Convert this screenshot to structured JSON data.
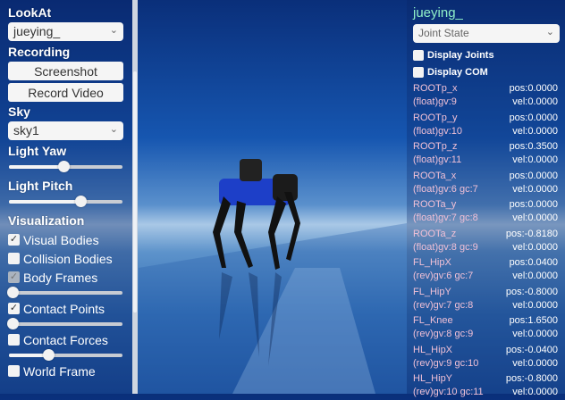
{
  "left": {
    "lookat_label": "LookAt",
    "lookat_value": "jueying_",
    "recording_label": "Recording",
    "screenshot_button": "Screenshot",
    "record_button": "Record Video",
    "sky_label": "Sky",
    "sky_value": "sky1",
    "light_yaw_label": "Light Yaw",
    "light_yaw_value": 0.48,
    "light_pitch_label": "Light Pitch",
    "light_pitch_value": 0.63,
    "visualization_label": "Visualization",
    "items": [
      {
        "label": "Visual Bodies",
        "checked": true
      },
      {
        "label": "Collision Bodies",
        "checked": false
      },
      {
        "label": "Body Frames",
        "checked": true,
        "disabled": true,
        "slider": 0.03
      },
      {
        "label": "Contact Points",
        "checked": true,
        "slider": 0.03
      },
      {
        "label": "Contact Forces",
        "checked": false,
        "slider": 0.35
      },
      {
        "label": "World Frame",
        "checked": false
      }
    ]
  },
  "right": {
    "title": "jueying_",
    "mode": "Joint State",
    "display_joints": "Display Joints",
    "display_com": "Display COM",
    "joints": [
      {
        "name": "ROOTp_x",
        "info": "(float)gv:9",
        "pos": "pos:0.0000",
        "vel": "vel:0.0000"
      },
      {
        "name": "ROOTp_y",
        "info": "(float)gv:10",
        "pos": "pos:0.0000",
        "vel": "vel:0.0000"
      },
      {
        "name": "ROOTp_z",
        "info": "(float)gv:11",
        "pos": "pos:0.3500",
        "vel": "vel:0.0000"
      },
      {
        "name": "ROOTa_x",
        "info": "(float)gv:6 gc:7",
        "pos": "pos:0.0000",
        "vel": "vel:0.0000"
      },
      {
        "name": "ROOTa_y",
        "info": "(float)gv:7 gc:8",
        "pos": "pos:0.0000",
        "vel": "vel:0.0000"
      },
      {
        "name": "ROOTa_z",
        "info": "(float)gv:8 gc:9",
        "pos": "pos:-0.8180",
        "vel": "vel:0.0000"
      },
      {
        "name": "FL_HipX",
        "info": "(rev)gv:6 gc:7",
        "pos": "pos:0.0400",
        "vel": "vel:0.0000"
      },
      {
        "name": "FL_HipY",
        "info": "(rev)gv:7 gc:8",
        "pos": "pos:-0.8000",
        "vel": "vel:0.0000"
      },
      {
        "name": "FL_Knee",
        "info": "(rev)gv:8 gc:9",
        "pos": "pos:1.6500",
        "vel": "vel:0.0000"
      },
      {
        "name": "HL_HipX",
        "info": "(rev)gv:9 gc:10",
        "pos": "pos:-0.0400",
        "vel": "vel:0.0000"
      },
      {
        "name": "HL_HipY",
        "info": "(rev)gv:10 gc:11",
        "pos": "pos:-0.8000",
        "vel": "vel:0.0000"
      }
    ]
  }
}
